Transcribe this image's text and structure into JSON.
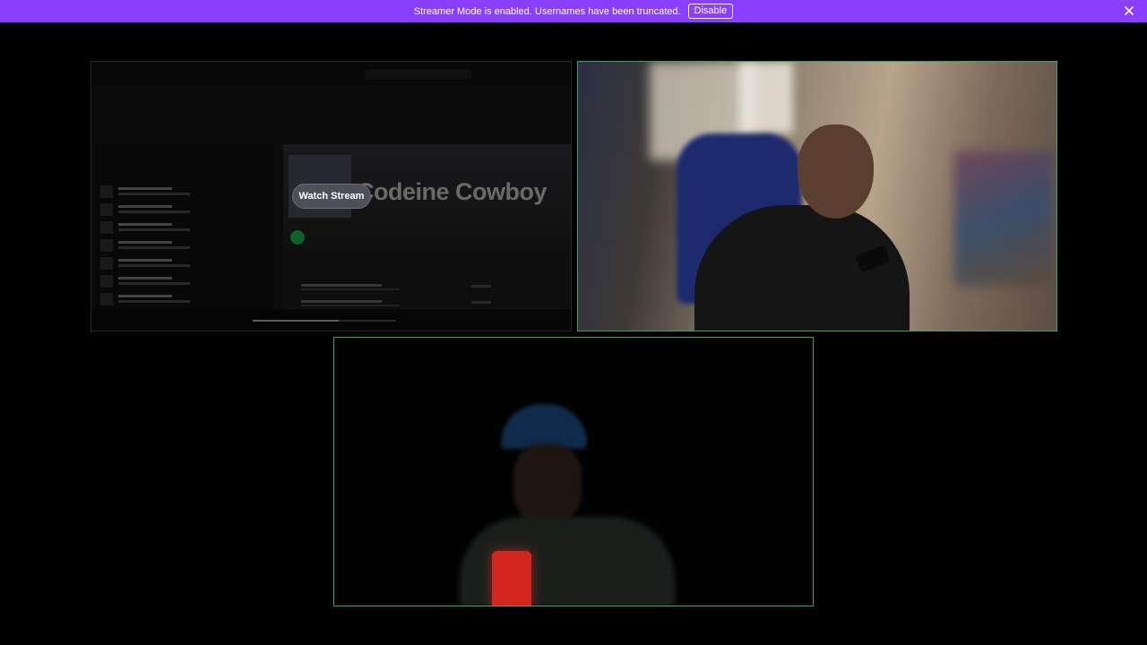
{
  "banner": {
    "message": "Streamer Mode is enabled. Usernames have been truncated.",
    "disable_label": "Disable",
    "close_icon": "close-icon",
    "color": "#8a3ffc"
  },
  "screenshare": {
    "song_title": "Codeine Cowboy",
    "watch_label": "Watch Stream",
    "progress": 0.6
  },
  "colors": {
    "speaking_border": "#3ba55d",
    "background": "#000000"
  }
}
